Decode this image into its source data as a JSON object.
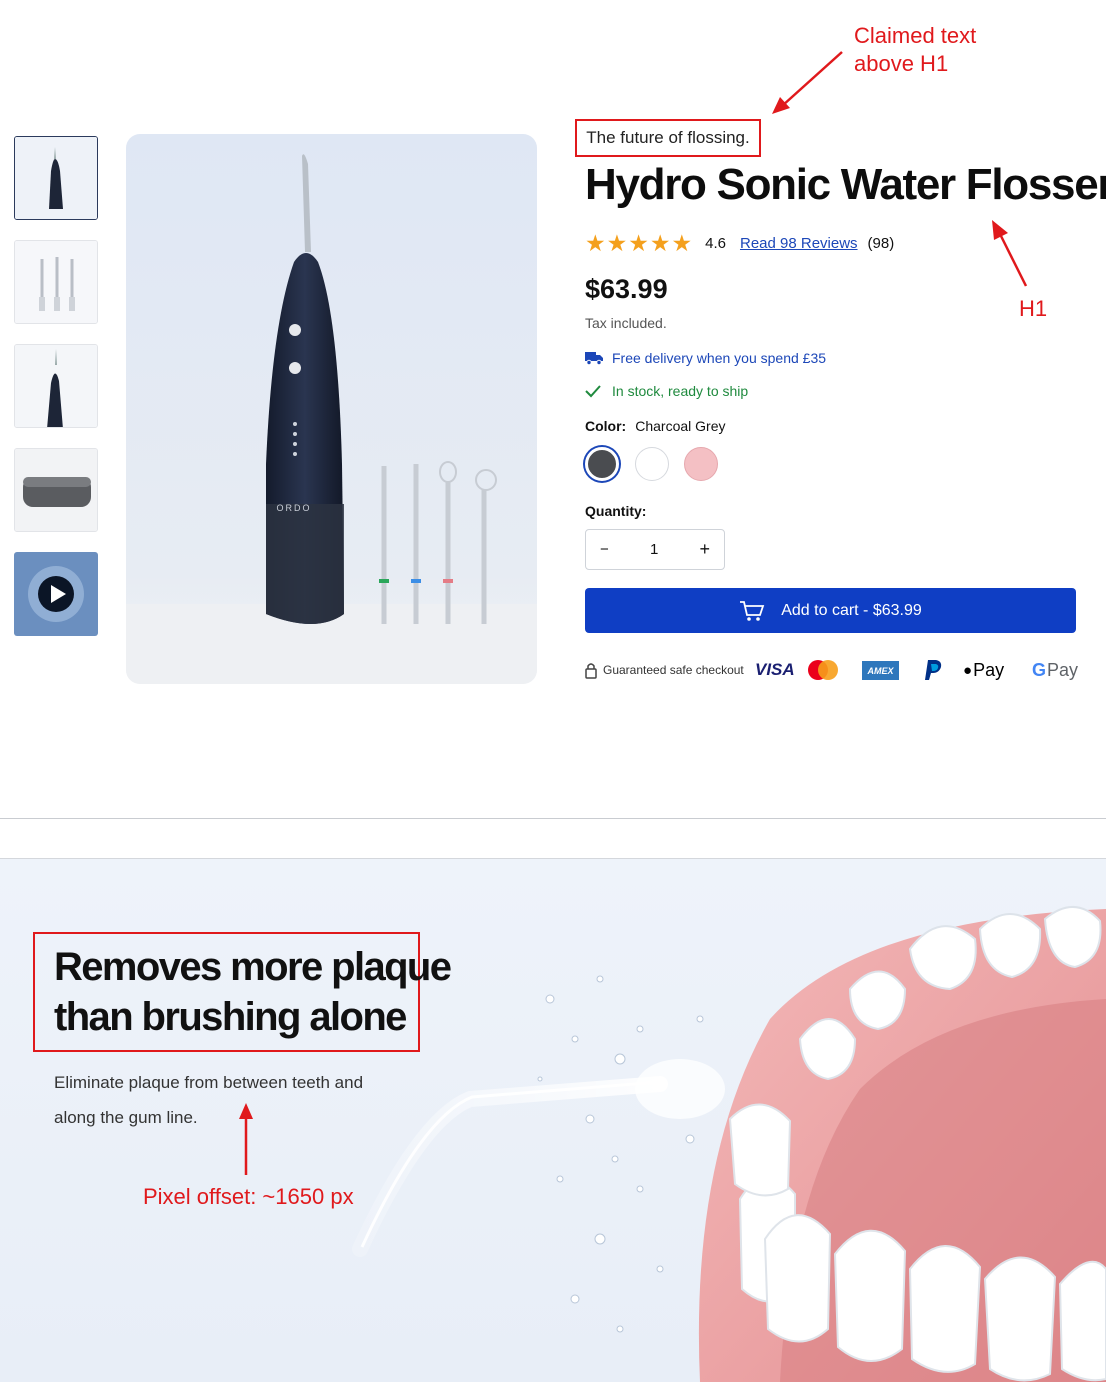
{
  "annotations": {
    "claimed": "Claimed text\nabove H1",
    "h1_label": "H1",
    "offset": "Pixel offset: ~1650 px"
  },
  "product": {
    "eyebrow": "The future of flossing.",
    "title": "Hydro Sonic Water Flosser",
    "rating_value": "4.6",
    "stars": 5,
    "reviews_link": "Read 98 Reviews",
    "reviews_count": "(98)",
    "price": "$63.99",
    "tax_note": "Tax included.",
    "delivery": "Free delivery when you spend £35",
    "stock": "In stock, ready to ship",
    "color_label": "Color:",
    "color_value": "Charcoal Grey",
    "colors": [
      "#4a4c50",
      "#ffffff",
      "#f4c0c4"
    ],
    "quantity_label": "Quantity:",
    "quantity_value": "1",
    "qty_minus": "−",
    "qty_plus": "+",
    "add_to_cart": "Add to cart - $63.99",
    "safe_checkout": "Guaranteed safe checkout",
    "payments": [
      "VISA",
      "mastercard",
      "AMEX",
      "PayPal",
      "Pay",
      "Pay"
    ],
    "brand_on_device": "ORDO"
  },
  "lower": {
    "heading_line1": "Removes more plaque",
    "heading_line2": "than brushing alone",
    "body_line1": "Eliminate plaque from between teeth and",
    "body_line2": "along the gum line."
  },
  "accent": "#0f3ec4",
  "annotation_color": "#e0191c"
}
